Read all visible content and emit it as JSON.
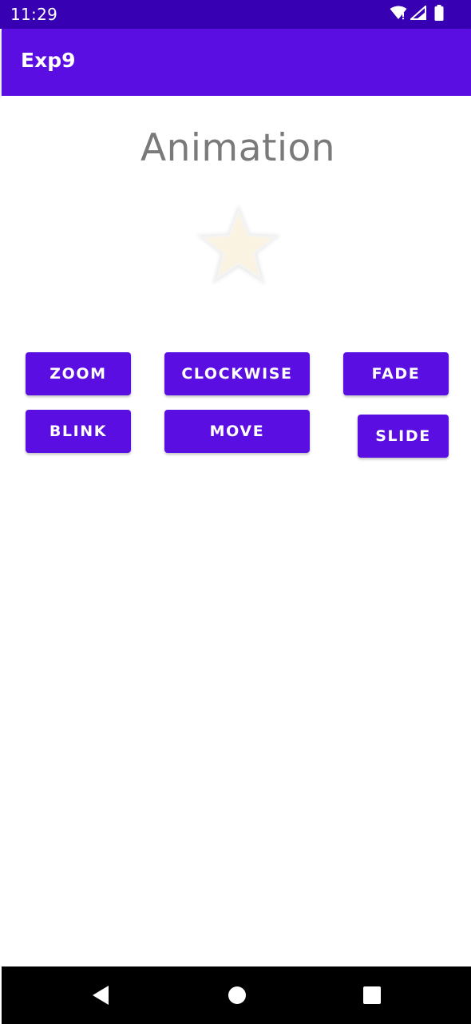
{
  "status_bar": {
    "time": "11:29",
    "icons": [
      "wifi-icon",
      "signal-icon",
      "battery-icon"
    ]
  },
  "app_bar": {
    "title": "Exp9"
  },
  "main": {
    "heading": "Animation",
    "image_icon": "star-icon",
    "buttons": {
      "zoom": "ZOOM",
      "clockwise": "CLOCKWISE",
      "fade": "FADE",
      "blink": "BLINK",
      "move": "MOVE",
      "slide": "SLIDE"
    }
  },
  "nav_bar": {
    "icons": [
      "back-icon",
      "home-icon",
      "recents-icon"
    ]
  },
  "colors": {
    "status_bar": "#3700b3",
    "app_bar": "#5a0ee2",
    "button": "#5a0ee2",
    "heading_text": "#7a7a7a"
  }
}
